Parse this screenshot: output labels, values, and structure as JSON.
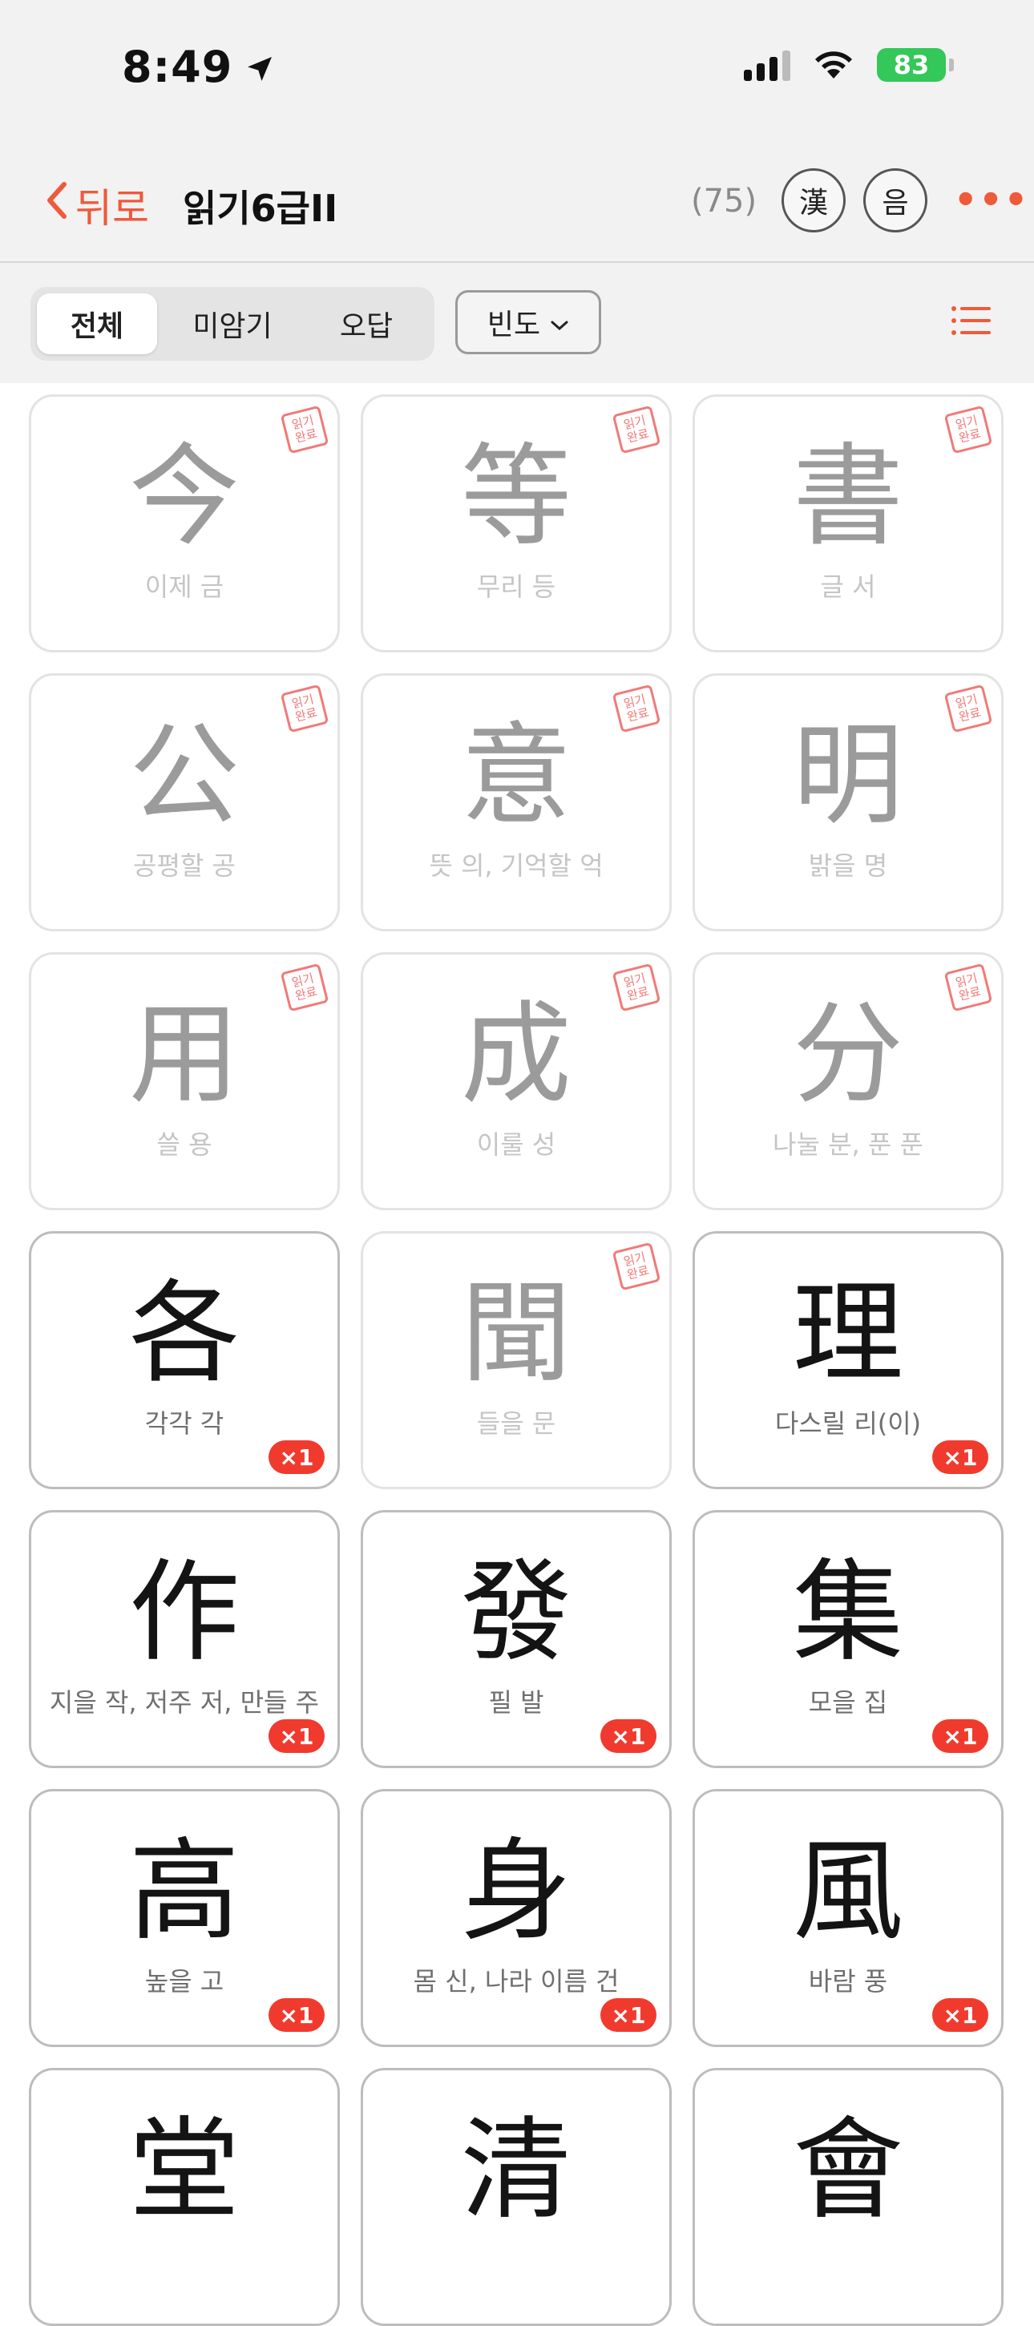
{
  "status": {
    "time": "8:49",
    "battery": "83"
  },
  "nav": {
    "back_label": "뒤로",
    "title": "읽기6급II",
    "count": "(75)",
    "hanja_button": "漢",
    "sound_button": "음",
    "more": "•••"
  },
  "filters": {
    "tabs": [
      {
        "label": "전체",
        "active": true
      },
      {
        "label": "미암기",
        "active": false
      },
      {
        "label": "오답",
        "active": false
      }
    ],
    "sort_label": "빈도"
  },
  "stamp_text": "읽기완료",
  "colors": {
    "accent": "#ee5a3a",
    "badge": "#f03a2e",
    "stamp": "#f07a78"
  },
  "cards": [
    {
      "hanja": "今",
      "meaning": "이제 금",
      "completed": true,
      "badge": ""
    },
    {
      "hanja": "等",
      "meaning": "무리 등",
      "completed": true,
      "badge": ""
    },
    {
      "hanja": "書",
      "meaning": "글 서",
      "completed": true,
      "badge": ""
    },
    {
      "hanja": "公",
      "meaning": "공평할 공",
      "completed": true,
      "badge": ""
    },
    {
      "hanja": "意",
      "meaning": "뜻 의, 기억할 억",
      "completed": true,
      "badge": ""
    },
    {
      "hanja": "明",
      "meaning": "밝을 명",
      "completed": true,
      "badge": ""
    },
    {
      "hanja": "用",
      "meaning": "쓸 용",
      "completed": true,
      "badge": ""
    },
    {
      "hanja": "成",
      "meaning": "이룰 성",
      "completed": true,
      "badge": ""
    },
    {
      "hanja": "分",
      "meaning": "나눌 분, 푼 푼",
      "completed": true,
      "badge": ""
    },
    {
      "hanja": "各",
      "meaning": "각각 각",
      "completed": false,
      "badge": "×1"
    },
    {
      "hanja": "聞",
      "meaning": "들을 문",
      "completed": true,
      "badge": ""
    },
    {
      "hanja": "理",
      "meaning": "다스릴 리(이)",
      "completed": false,
      "badge": "×1"
    },
    {
      "hanja": "作",
      "meaning": "지을 작, 저주 저, 만들 주",
      "completed": false,
      "badge": "×1"
    },
    {
      "hanja": "發",
      "meaning": "필 발",
      "completed": false,
      "badge": "×1"
    },
    {
      "hanja": "集",
      "meaning": "모을 집",
      "completed": false,
      "badge": "×1"
    },
    {
      "hanja": "高",
      "meaning": "높을 고",
      "completed": false,
      "badge": "×1"
    },
    {
      "hanja": "身",
      "meaning": "몸 신, 나라 이름 건",
      "completed": false,
      "badge": "×1"
    },
    {
      "hanja": "風",
      "meaning": "바람 풍",
      "completed": false,
      "badge": "×1"
    },
    {
      "hanja": "堂",
      "meaning": "",
      "completed": false,
      "badge": ""
    },
    {
      "hanja": "清",
      "meaning": "",
      "completed": false,
      "badge": ""
    },
    {
      "hanja": "會",
      "meaning": "",
      "completed": false,
      "badge": ""
    }
  ]
}
